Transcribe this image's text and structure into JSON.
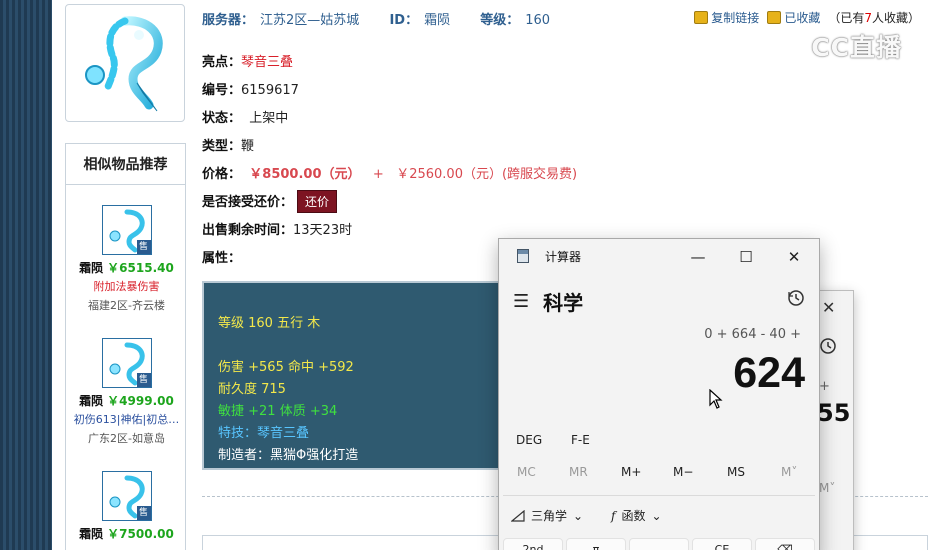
{
  "header": {
    "server_label": "服务器：",
    "server_value": "江苏2区—姑苏城",
    "id_label": "ID：",
    "id_value": "霜陨",
    "level_label": "等级：",
    "level_value": "160"
  },
  "actions": {
    "copy_link": "复制链接",
    "favorited": "已收藏",
    "fav_prefix": "（已有",
    "fav_count": "7",
    "fav_suffix": "人收藏）"
  },
  "watermark": "CC直播",
  "details": {
    "highlight_label": "亮点：",
    "highlight_value": "琴音三叠",
    "number_label": "编号：",
    "number_value": "6159617",
    "status_label": "状态：",
    "status_value": "上架中",
    "type_label": "类型：",
    "type_value": "鞭",
    "price_label": "价格：",
    "price_value": "￥8500.00（元）",
    "price_plus": "+",
    "cross_fee": "￥2560.00（元）(跨服交易费)",
    "bargain_label": "是否接受还价：",
    "bargain_button": "还价",
    "remaining_label": "出售剩余时间：",
    "remaining_value": "13天23时",
    "attr_label": "属性："
  },
  "similar": {
    "title": "相似物品推荐",
    "items": [
      {
        "name": "霜陨",
        "price": "￥6515.40",
        "note": "附加法暴伤害",
        "server": "福建2区-齐云楼",
        "sell": "售"
      },
      {
        "name": "霜陨",
        "price": "￥4999.00",
        "note": "初伤613|神佑|初总…",
        "server": "广东2区-如意岛",
        "sell": "售"
      },
      {
        "name": "霜陨",
        "price": "￥7500.00",
        "note": "",
        "server": "",
        "sell": "售"
      }
    ]
  },
  "attributes": {
    "line1": "等级 160 五行 木",
    "line2": "伤害 +565 命中 +592",
    "line3": "耐久度 715",
    "line4": "敏捷 +21 体质 +34",
    "line5": "特技：琴音三叠",
    "line6": "制造者：黑猯Φ强化打造"
  },
  "calculator": {
    "app_title": "计算器",
    "mode": "科学",
    "expression": "0 + 664 - 40 +",
    "display": "624",
    "deg": "DEG",
    "fe": "F-E",
    "mem": [
      "MC",
      "MR",
      "M+",
      "M−",
      "MS",
      "M˅"
    ],
    "trig": "三角学",
    "func": "函数",
    "key_labels": [
      "2nd",
      "π",
      "",
      "CE",
      "⌫"
    ]
  },
  "calculator_back": {
    "expr": "+",
    "num": "55",
    "mv": "M˅"
  }
}
